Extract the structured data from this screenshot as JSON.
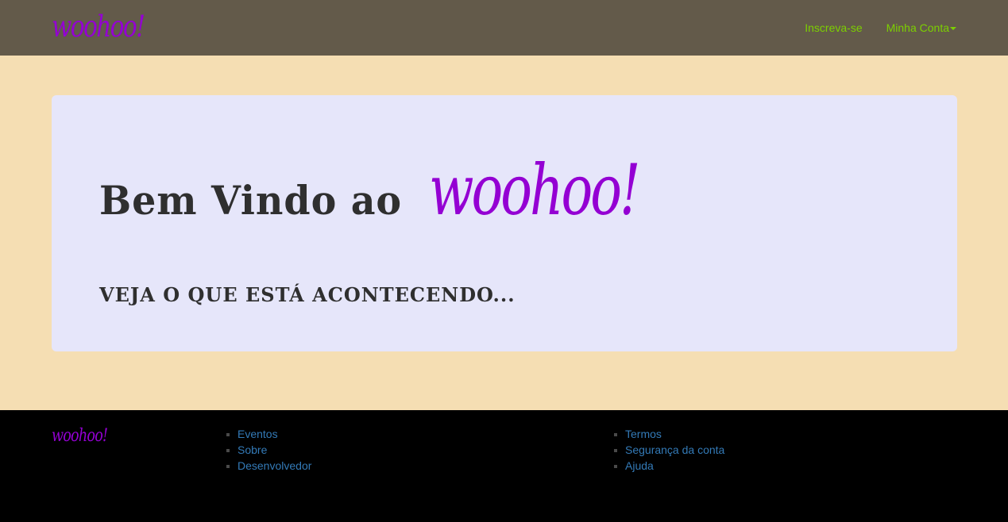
{
  "navbar": {
    "brand": "woohoo!",
    "links": {
      "signup": "Inscreva-se",
      "account": "Minha Conta"
    }
  },
  "hero": {
    "title_prefix": "Bem Vindo ao",
    "title_brand": "woohoo!",
    "subtitle": "VEJA O QUE ESTÁ ACONTECENDO..."
  },
  "footer": {
    "brand": "woohoo!",
    "col1": [
      "Eventos",
      "Sobre",
      "Desenvolvedor"
    ],
    "col2": [
      "Termos",
      "Segurança da conta",
      "Ajuda"
    ]
  },
  "colors": {
    "navbar_bg": "#635a4a",
    "brand": "#9400d3",
    "nav_link": "#7cd000",
    "page_bg": "#f5deb3",
    "jumbotron_bg": "#e6e6fa",
    "footer_bg": "#000000",
    "footer_link": "#337ab7"
  }
}
